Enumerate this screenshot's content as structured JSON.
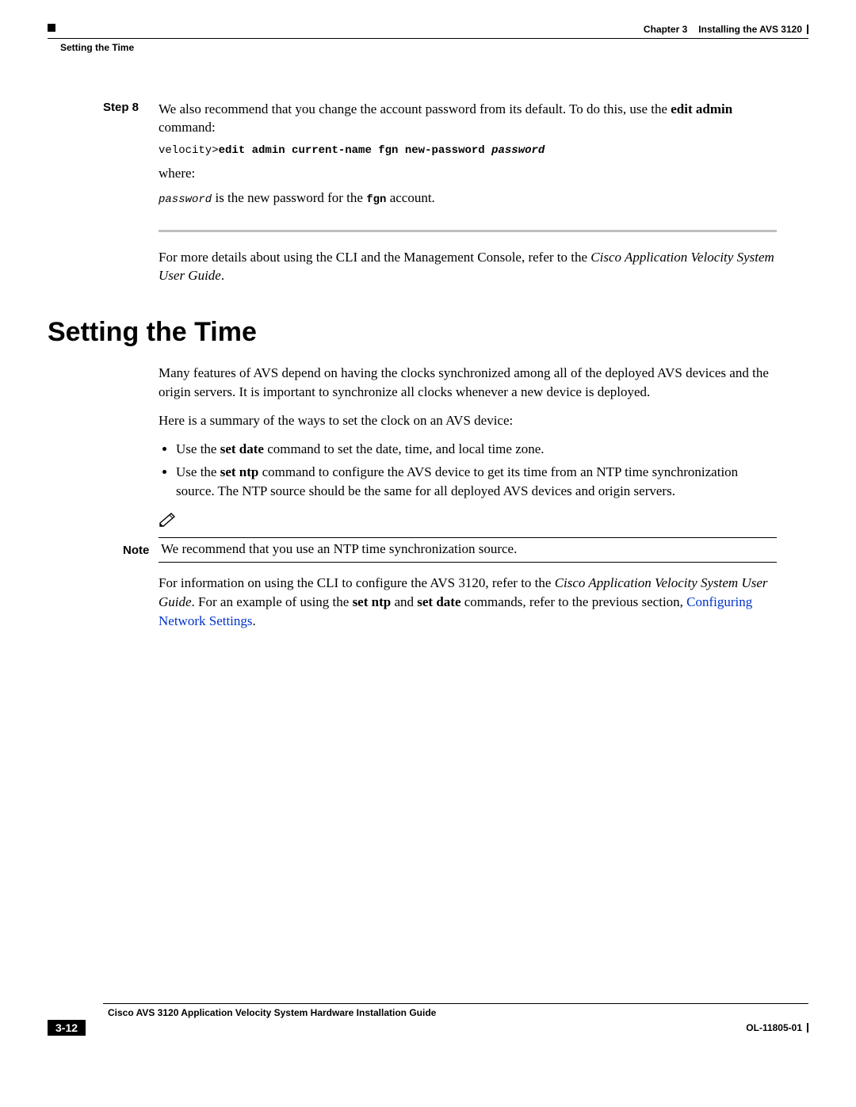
{
  "header": {
    "chapter_label": "Chapter 3",
    "chapter_title": "Installing the AVS 3120",
    "section_label": "Setting the Time"
  },
  "step": {
    "label": "Step 8",
    "line1_pre": "We also recommend that you change the account password from its default. To do this, use the ",
    "line1_bold": "edit admin",
    "line1_post": " command:",
    "code_prompt": "velocity>",
    "code_bold": "edit admin current-name fgn new-password ",
    "code_italic": "password",
    "where": "where:",
    "pw_italic": "password",
    "pw_mid": " is the new password for the ",
    "pw_bold": "fgn",
    "pw_end": " account."
  },
  "moreinfo": {
    "pre": "For more details about using the CLI and the Management Console, refer to the ",
    "italic": "Cisco Application Velocity System User Guide",
    "post": "."
  },
  "h1": "Setting the Time",
  "intro": "Many features of AVS depend on having the clocks synchronized among all of the deployed AVS devices and the origin servers. It is important to synchronize all clocks whenever a new device is deployed.",
  "summary": "Here is a summary of the ways to set the clock on an AVS device:",
  "bullets": {
    "b1_pre": "Use the ",
    "b1_bold": "set date",
    "b1_post": " command to set the date, time, and local time zone.",
    "b2_pre": "Use the ",
    "b2_bold": "set ntp",
    "b2_post": " command to configure the AVS device to get its time from an NTP time synchronization source. The NTP source should be the same for all deployed AVS devices and origin servers."
  },
  "note": {
    "label": "Note",
    "text": "We recommend that you use an NTP time synchronization source."
  },
  "closing": {
    "pre": "For information on using the CLI to configure the AVS 3120, refer to the ",
    "italic": "Cisco Application Velocity System User Guide",
    "mid1": ". For an example of using the ",
    "bold1": "set ntp",
    "mid2": " and ",
    "bold2": "set date",
    "mid3": " commands, refer to the previous section, ",
    "link": "Configuring Network Settings",
    "post": "."
  },
  "footer": {
    "doc_title": "Cisco AVS 3120 Application Velocity System Hardware Installation Guide",
    "page": "3-12",
    "doc_id": "OL-11805-01"
  }
}
